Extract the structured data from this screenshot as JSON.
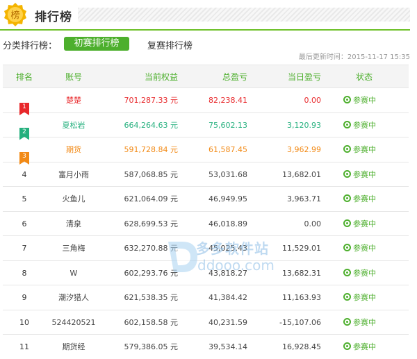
{
  "header": {
    "badge_char": "榜",
    "title": "排行榜"
  },
  "filter": {
    "label": "分类排行榜：",
    "tabs": [
      "初赛排行榜",
      "复赛排行榜"
    ],
    "active": 0
  },
  "updated": "最后更新时间：2015-11-17 15:35",
  "table": {
    "columns": [
      "排名",
      "账号",
      "当前权益",
      "总盈亏",
      "当日盈亏",
      "状态"
    ],
    "rows": [
      {
        "rank": "1",
        "account": "楚楚",
        "equity": "701,287.33 元",
        "total": "82,238.41",
        "daily": "0.00",
        "status": "参赛中"
      },
      {
        "rank": "2",
        "account": "夏松岩",
        "equity": "664,264.63 元",
        "total": "75,602.13",
        "daily": "3,120.93",
        "status": "参赛中"
      },
      {
        "rank": "3",
        "account": "期货",
        "equity": "591,728.84 元",
        "total": "61,587.45",
        "daily": "3,962.99",
        "status": "参赛中"
      },
      {
        "rank": "4",
        "account": "富月小雨",
        "equity": "587,068.85 元",
        "total": "53,031.68",
        "daily": "13,682.01",
        "status": "参赛中"
      },
      {
        "rank": "5",
        "account": "火鱼儿",
        "equity": "621,064.09 元",
        "total": "46,949.95",
        "daily": "3,963.71",
        "status": "参赛中"
      },
      {
        "rank": "6",
        "account": "清泉",
        "equity": "628,699.53 元",
        "total": "46,018.89",
        "daily": "0.00",
        "status": "参赛中"
      },
      {
        "rank": "7",
        "account": "三角梅",
        "equity": "632,270.88 元",
        "total": "45,025.43",
        "daily": "11,529.01",
        "status": "参赛中"
      },
      {
        "rank": "8",
        "account": "W",
        "equity": "602,293.76 元",
        "total": "43,818.27",
        "daily": "13,682.31",
        "status": "参赛中"
      },
      {
        "rank": "9",
        "account": "潮汐猎人",
        "equity": "621,538.35 元",
        "total": "41,384.42",
        "daily": "11,163.93",
        "status": "参赛中"
      },
      {
        "rank": "10",
        "account": "524420521",
        "equity": "602,158.58 元",
        "total": "40,231.59",
        "daily": "-15,107.06",
        "status": "参赛中"
      },
      {
        "rank": "11",
        "account": "期货经",
        "equity": "579,386.05 元",
        "total": "39,534.14",
        "daily": "16,928.45",
        "status": "参赛中"
      }
    ]
  },
  "colors": {
    "accent": "#4daf2d",
    "rank1": "#e8282b",
    "rank2": "#25b07e",
    "rank3": "#f28a16",
    "normal": "#444444"
  },
  "watermark": {
    "cn": "多多软件站",
    "en": "ddooo.com"
  }
}
